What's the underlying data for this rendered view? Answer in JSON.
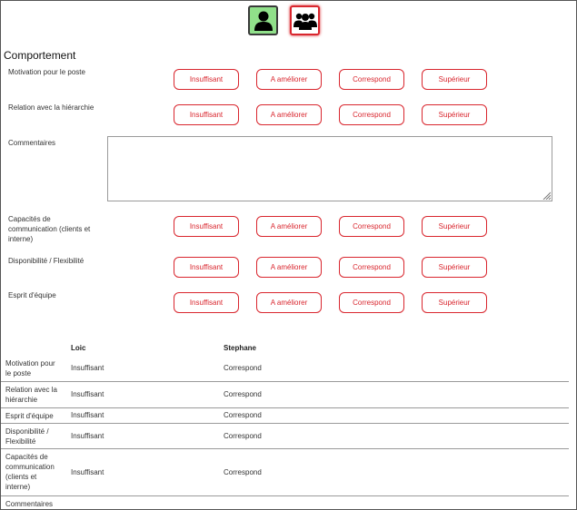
{
  "section_title": "Comportement",
  "rating_options": [
    "Insuffisant",
    "A améliorer",
    "Correspond",
    "Supérieur"
  ],
  "criteria": [
    {
      "label": "Motivation pour le poste"
    },
    {
      "label": "Relation avec la hiérarchie"
    },
    {
      "label": "Capacités de communication (clients et interne)"
    },
    {
      "label": "Disponibilité / Flexibilité"
    },
    {
      "label": "Esprit d'équipe"
    }
  ],
  "comments_label": "Commentaires",
  "summary": {
    "columns": [
      "Loic",
      "Stephane"
    ],
    "rows": [
      {
        "label": "Motivation pour le poste",
        "values": [
          "Insuffisant",
          "Correspond"
        ]
      },
      {
        "label": "Relation avec la hiérarchie",
        "values": [
          "Insuffisant",
          "Correspond"
        ]
      },
      {
        "label": "Esprit d'équipe",
        "values": [
          "Insuffisant",
          "Correspond"
        ]
      },
      {
        "label": "Disponibilité / Flexibilité",
        "values": [
          "Insuffisant",
          "Correspond"
        ]
      },
      {
        "label": "Capacités de communication (clients et interne)",
        "values": [
          "Insuffisant",
          "Correspond"
        ]
      },
      {
        "label": "Commentaires",
        "values": [
          "",
          ""
        ]
      }
    ]
  },
  "toggles": [
    {
      "icon": "single-user-icon",
      "state": "active"
    },
    {
      "icon": "team-users-icon",
      "state": "inactive"
    }
  ],
  "colors": {
    "accent": "#d9262e",
    "active_toggle": "#90e08a"
  }
}
